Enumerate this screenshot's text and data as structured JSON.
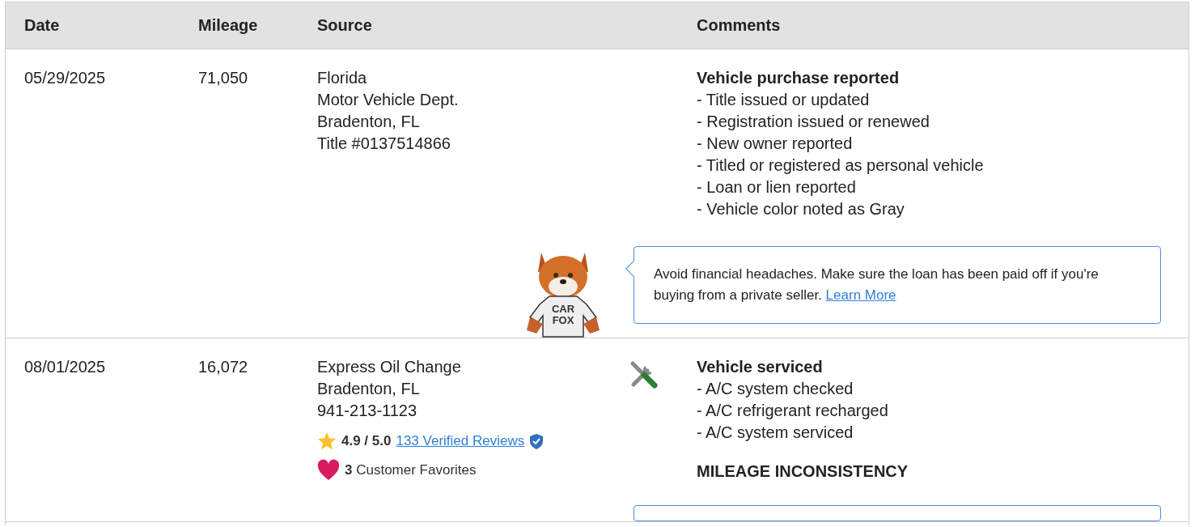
{
  "table": {
    "columns": [
      "Date",
      "Mileage",
      "Source",
      "Comments"
    ],
    "rows": [
      {
        "kind": "registration",
        "date": "05/29/2025",
        "mileage": "71,050",
        "source_lines": [
          "Florida",
          "Motor Vehicle Dept.",
          "Bradenton, FL",
          "Title #0137514866"
        ],
        "comment_title": "Vehicle purchase reported",
        "comment_items": [
          "- Title issued or updated",
          "- Registration issued or renewed",
          "- New owner reported",
          "- Titled or registered as personal vehicle",
          "- Loan or lien reported",
          "- Vehicle color noted as Gray"
        ],
        "tip": {
          "text": "Avoid financial headaches. Make sure the loan has been paid off if you're buying from a private seller.",
          "link": "Learn More",
          "shirt_lines": [
            "CAR",
            "FOX"
          ]
        }
      },
      {
        "kind": "service",
        "date": "08/01/2025",
        "mileage": "16,072",
        "source_lines": [
          "Express Oil Change",
          "Bradenton, FL",
          "941-213-1123"
        ],
        "rating": "4.9 / 5.0",
        "reviews_link": "133 Verified Reviews",
        "verified": true,
        "favorites_count": "3",
        "favorites_label": "Customer Favorites",
        "comment_title": "Vehicle serviced",
        "comment_items": [
          "- A/C system checked",
          "- A/C refrigerant recharged",
          "- A/C system serviced"
        ],
        "alert": "MILEAGE INCONSISTENCY",
        "tip_box_partial": true
      }
    ]
  }
}
